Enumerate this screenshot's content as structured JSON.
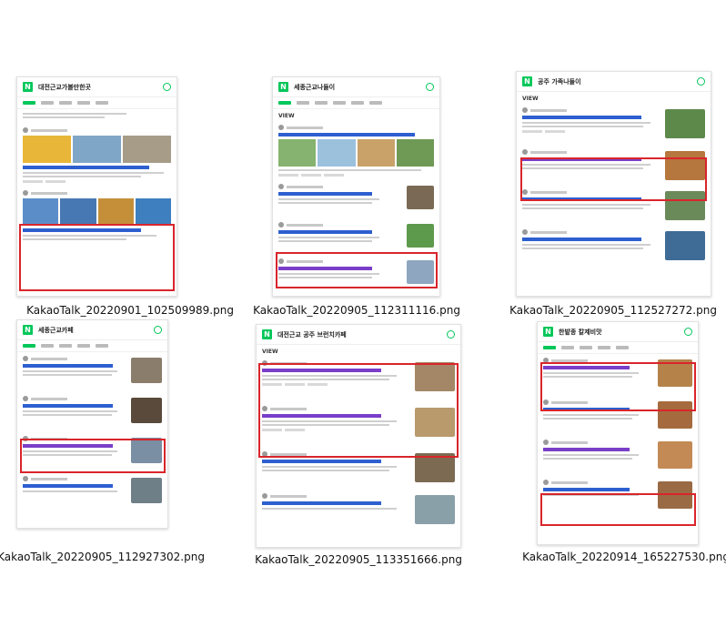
{
  "files": [
    {
      "name": "KakaoTalk_20220901_102509989.png",
      "query": "대전근교가볼만한곳"
    },
    {
      "name": "KakaoTalk_20220905_112311116.png",
      "query": "세종근교나들이"
    },
    {
      "name": "KakaoTalk_20220905_112527272.png",
      "query": "공주 가족나들이"
    },
    {
      "name": "KakaoTalk_20220905_112927302.png",
      "query": "세종근교카페"
    },
    {
      "name": "KakaoTalk_20220905_113351666.png",
      "query": "대전근교 공주 브런치카페"
    },
    {
      "name": "KakaoTalk_20220914_165227530.png",
      "query": "한밭종 칼제비맛"
    }
  ],
  "colors": {
    "naver_green": "#03c75a",
    "highlight_red": "#d9252b",
    "link_blue": "#2d5fd0"
  },
  "labels": {
    "view": "VIEW"
  }
}
